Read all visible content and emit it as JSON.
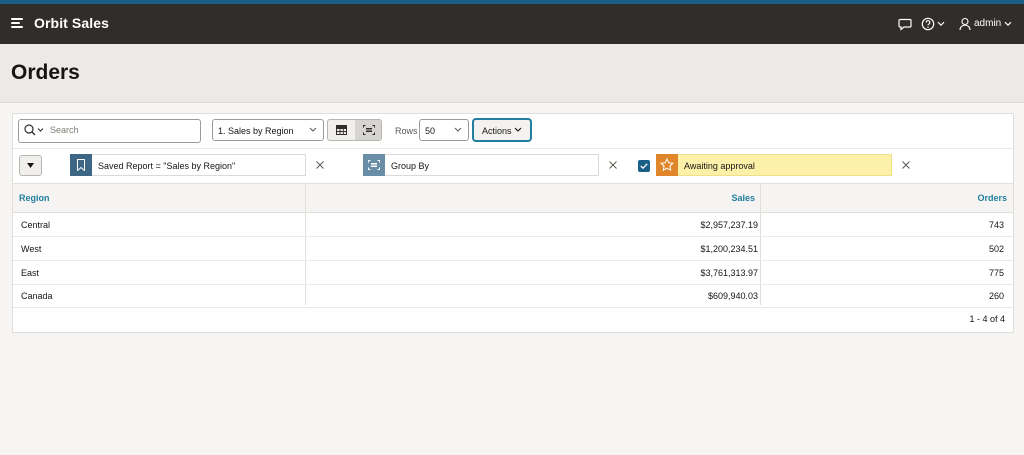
{
  "header": {
    "app_title": "Orbit Sales",
    "user": "admin",
    "icons": [
      "menu-icon",
      "chat-icon",
      "help-icon",
      "user-icon"
    ]
  },
  "page": {
    "title": "Orders"
  },
  "toolbar": {
    "search_placeholder": "Search",
    "report_select": "1. Sales by Region",
    "rows_label": "Rows",
    "rows_value": "50",
    "actions_label": "Actions"
  },
  "filters": [
    {
      "icon": "bookmark-icon",
      "label": "Saved Report = \"Sales by Region\"",
      "icon_color": "#3d6584"
    },
    {
      "icon": "group-by-icon",
      "label": "Group By",
      "icon_color": "#6b8ea8"
    },
    {
      "icon": "star-icon",
      "label": "Awaiting approval",
      "icon_color": "#e0852a",
      "highlight": "#fdf1a9",
      "checked": true
    }
  ],
  "table": {
    "columns": [
      "Region",
      "Sales",
      "Orders"
    ],
    "rows": [
      [
        "Central",
        "$2,957,237.19",
        "743"
      ],
      [
        "West",
        "$1,200,234.51",
        "502"
      ],
      [
        "East",
        "$3,761,313.97",
        "775"
      ],
      [
        "Canada",
        "$609,940.03",
        "260"
      ]
    ],
    "pagination": "1 - 4 of 4"
  },
  "colors": {
    "header_bg": "#312d2a",
    "accent": "#227e9e",
    "top_stripe": "#1a5f87"
  }
}
